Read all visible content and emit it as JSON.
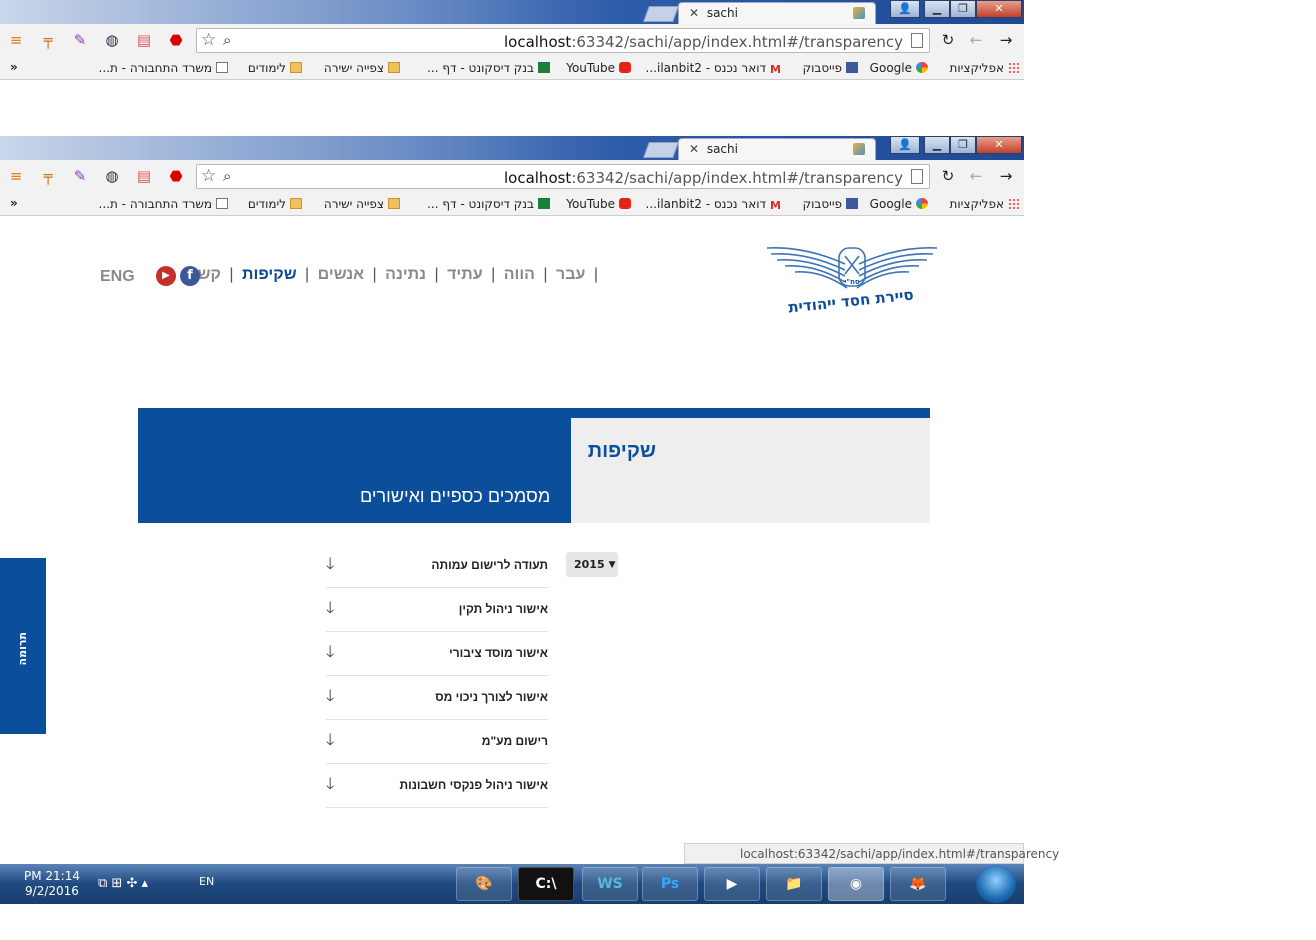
{
  "browser": {
    "tab_title": "sachi",
    "url_host": "localhost",
    "url_rest": ":63342/sachi/app/index.html#/transparency",
    "bookmarks": [
      {
        "label": "אפליקציות",
        "icon": "apps"
      },
      {
        "label": "Google",
        "icon": "gg"
      },
      {
        "label": "פייסבוק",
        "icon": "fb"
      },
      {
        "label": "דואר נכנס - ilanbit2...",
        "icon": "gm"
      },
      {
        "label": "YouTube",
        "icon": "yt"
      },
      {
        "label": "בנק דיסקונט - דף ...",
        "icon": "bank"
      },
      {
        "label": "צפייה ישירה",
        "icon": "folder"
      },
      {
        "label": "לימודים",
        "icon": "folder"
      },
      {
        "label": "משרד התחבורה - ת...",
        "icon": "page"
      }
    ],
    "bookmarks_overflow": "»"
  },
  "site": {
    "logo_text": "סיירת חסד ייהודית",
    "logo_badge": "סח\"י",
    "nav": [
      {
        "label": "עבר",
        "active": false
      },
      {
        "label": "הווה",
        "active": false
      },
      {
        "label": "עתיד",
        "active": false
      },
      {
        "label": "נתינה",
        "active": false
      },
      {
        "label": "אנשים",
        "active": false
      },
      {
        "label": "שקיפות",
        "active": true
      },
      {
        "label": "קשר",
        "active": false
      }
    ],
    "nav_separator": "|",
    "lang_switch": "ENG",
    "hero_title": "שקיפות",
    "hero_subtitle": "מסמכים כספיים ואישורים",
    "year_select": "2015",
    "documents": [
      "תעודה לרישום עמותה",
      "אישור ניהול תקין",
      "אישור מוסד ציבורי",
      "אישור לצורך ניכוי מס",
      "רישום מע\"מ",
      "אישור ניהול פנקסי חשבונות"
    ],
    "donate_label": "תרומה"
  },
  "status_url": "localhost:63342/sachi/app/index.html#/transparency",
  "taskbar": {
    "time": "PM 21:14",
    "date": "9/2/2016",
    "lang": "EN",
    "apps": [
      "paint",
      "cmd",
      "WS",
      "Ps",
      "media",
      "explorer",
      "chrome",
      "firefox"
    ]
  },
  "colors": {
    "brand_blue": "#0b4f9c",
    "hero_grey": "#eeeeee"
  }
}
